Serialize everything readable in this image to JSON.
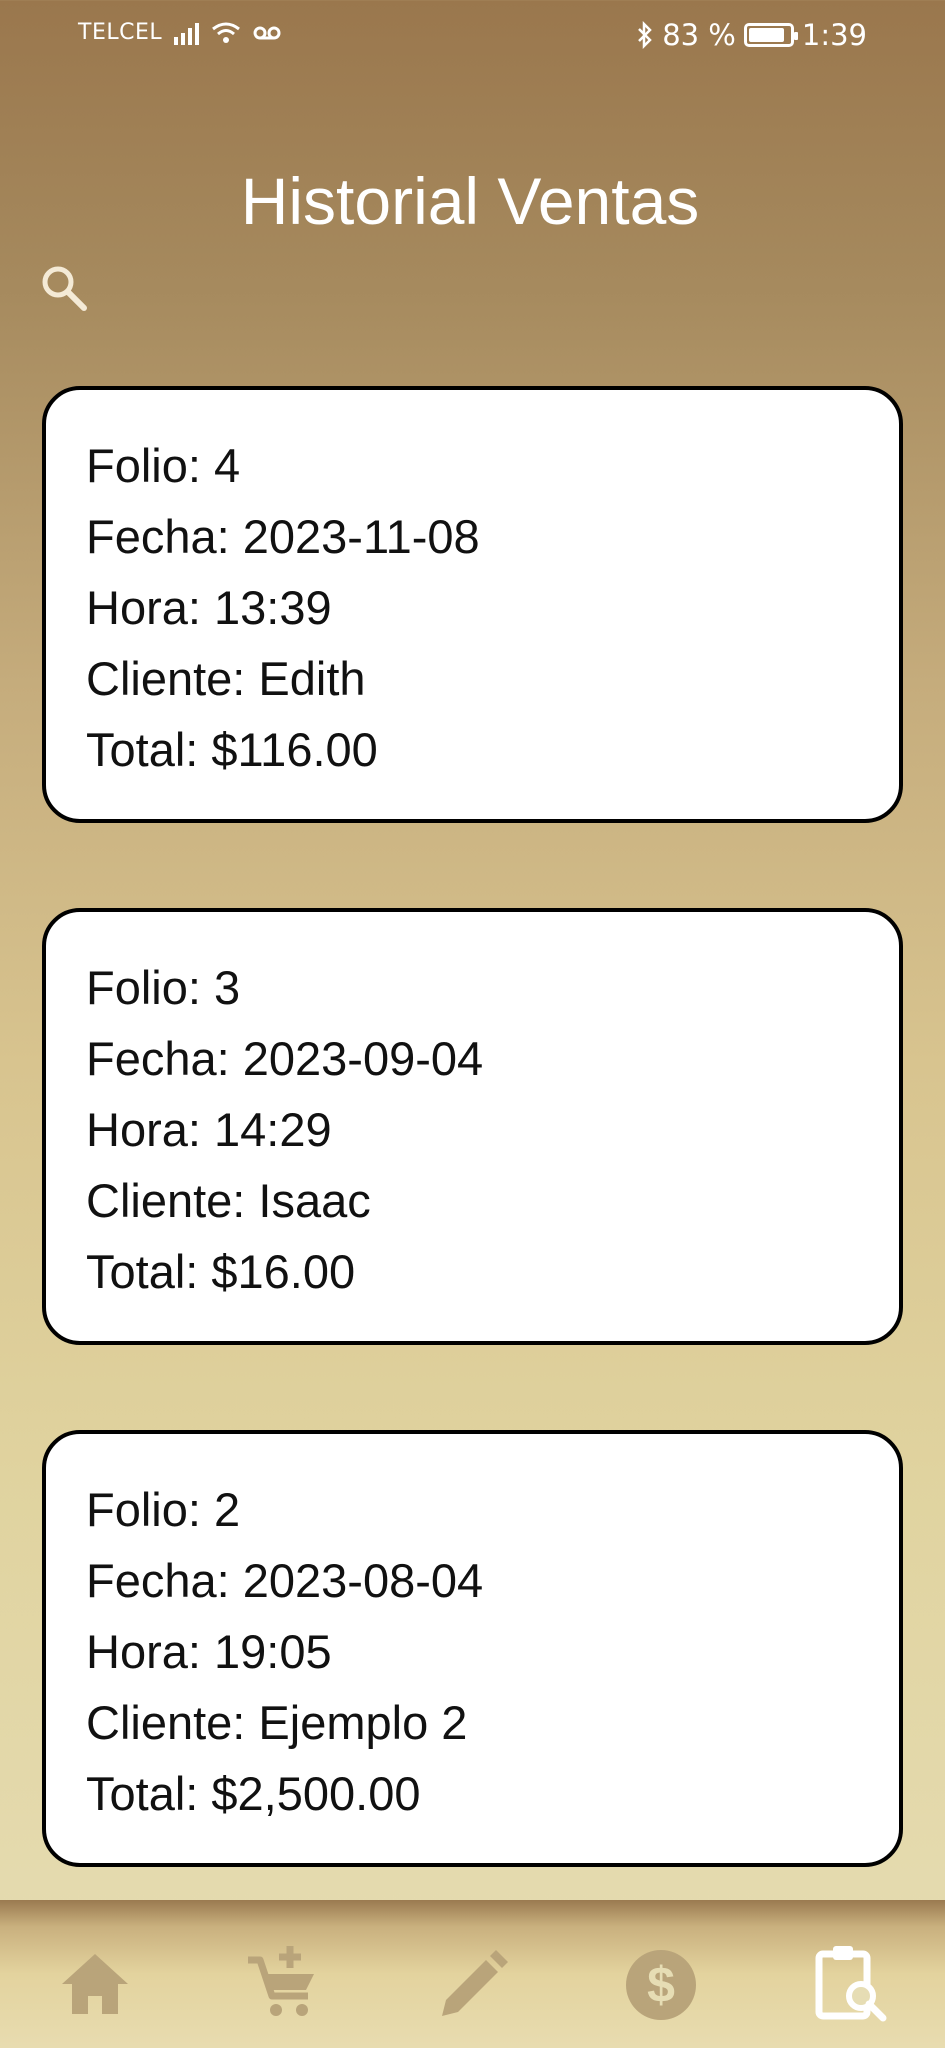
{
  "status_bar": {
    "carrier": "TELCEL",
    "battery": "83 %",
    "time": "1:39"
  },
  "header": {
    "title": "Historial Ventas"
  },
  "sales": [
    {
      "folio": "Folio: 4",
      "fecha": "Fecha: 2023-11-08",
      "hora": "Hora: 13:39",
      "cliente": "Cliente: Edith",
      "total": "Total: $116.00"
    },
    {
      "folio": "Folio: 3",
      "fecha": "Fecha: 2023-09-04",
      "hora": "Hora: 14:29",
      "cliente": "Cliente: Isaac",
      "total": "Total: $16.00"
    },
    {
      "folio": "Folio: 2",
      "fecha": "Fecha: 2023-08-04",
      "hora": "Hora: 19:05",
      "cliente": "Cliente: Ejemplo 2",
      "total": "Total: $2,500.00"
    }
  ],
  "nav": {
    "items": [
      {
        "icon": "home-icon",
        "active": false
      },
      {
        "icon": "cart-add-icon",
        "active": false
      },
      {
        "icon": "pencil-icon",
        "active": false
      },
      {
        "icon": "dollar-icon",
        "active": false
      },
      {
        "icon": "clipboard-search-icon",
        "active": true
      }
    ]
  },
  "colors": {
    "nav_inactive": "#b9a47a",
    "nav_active": "#ffffff",
    "card_border": "#000000"
  }
}
